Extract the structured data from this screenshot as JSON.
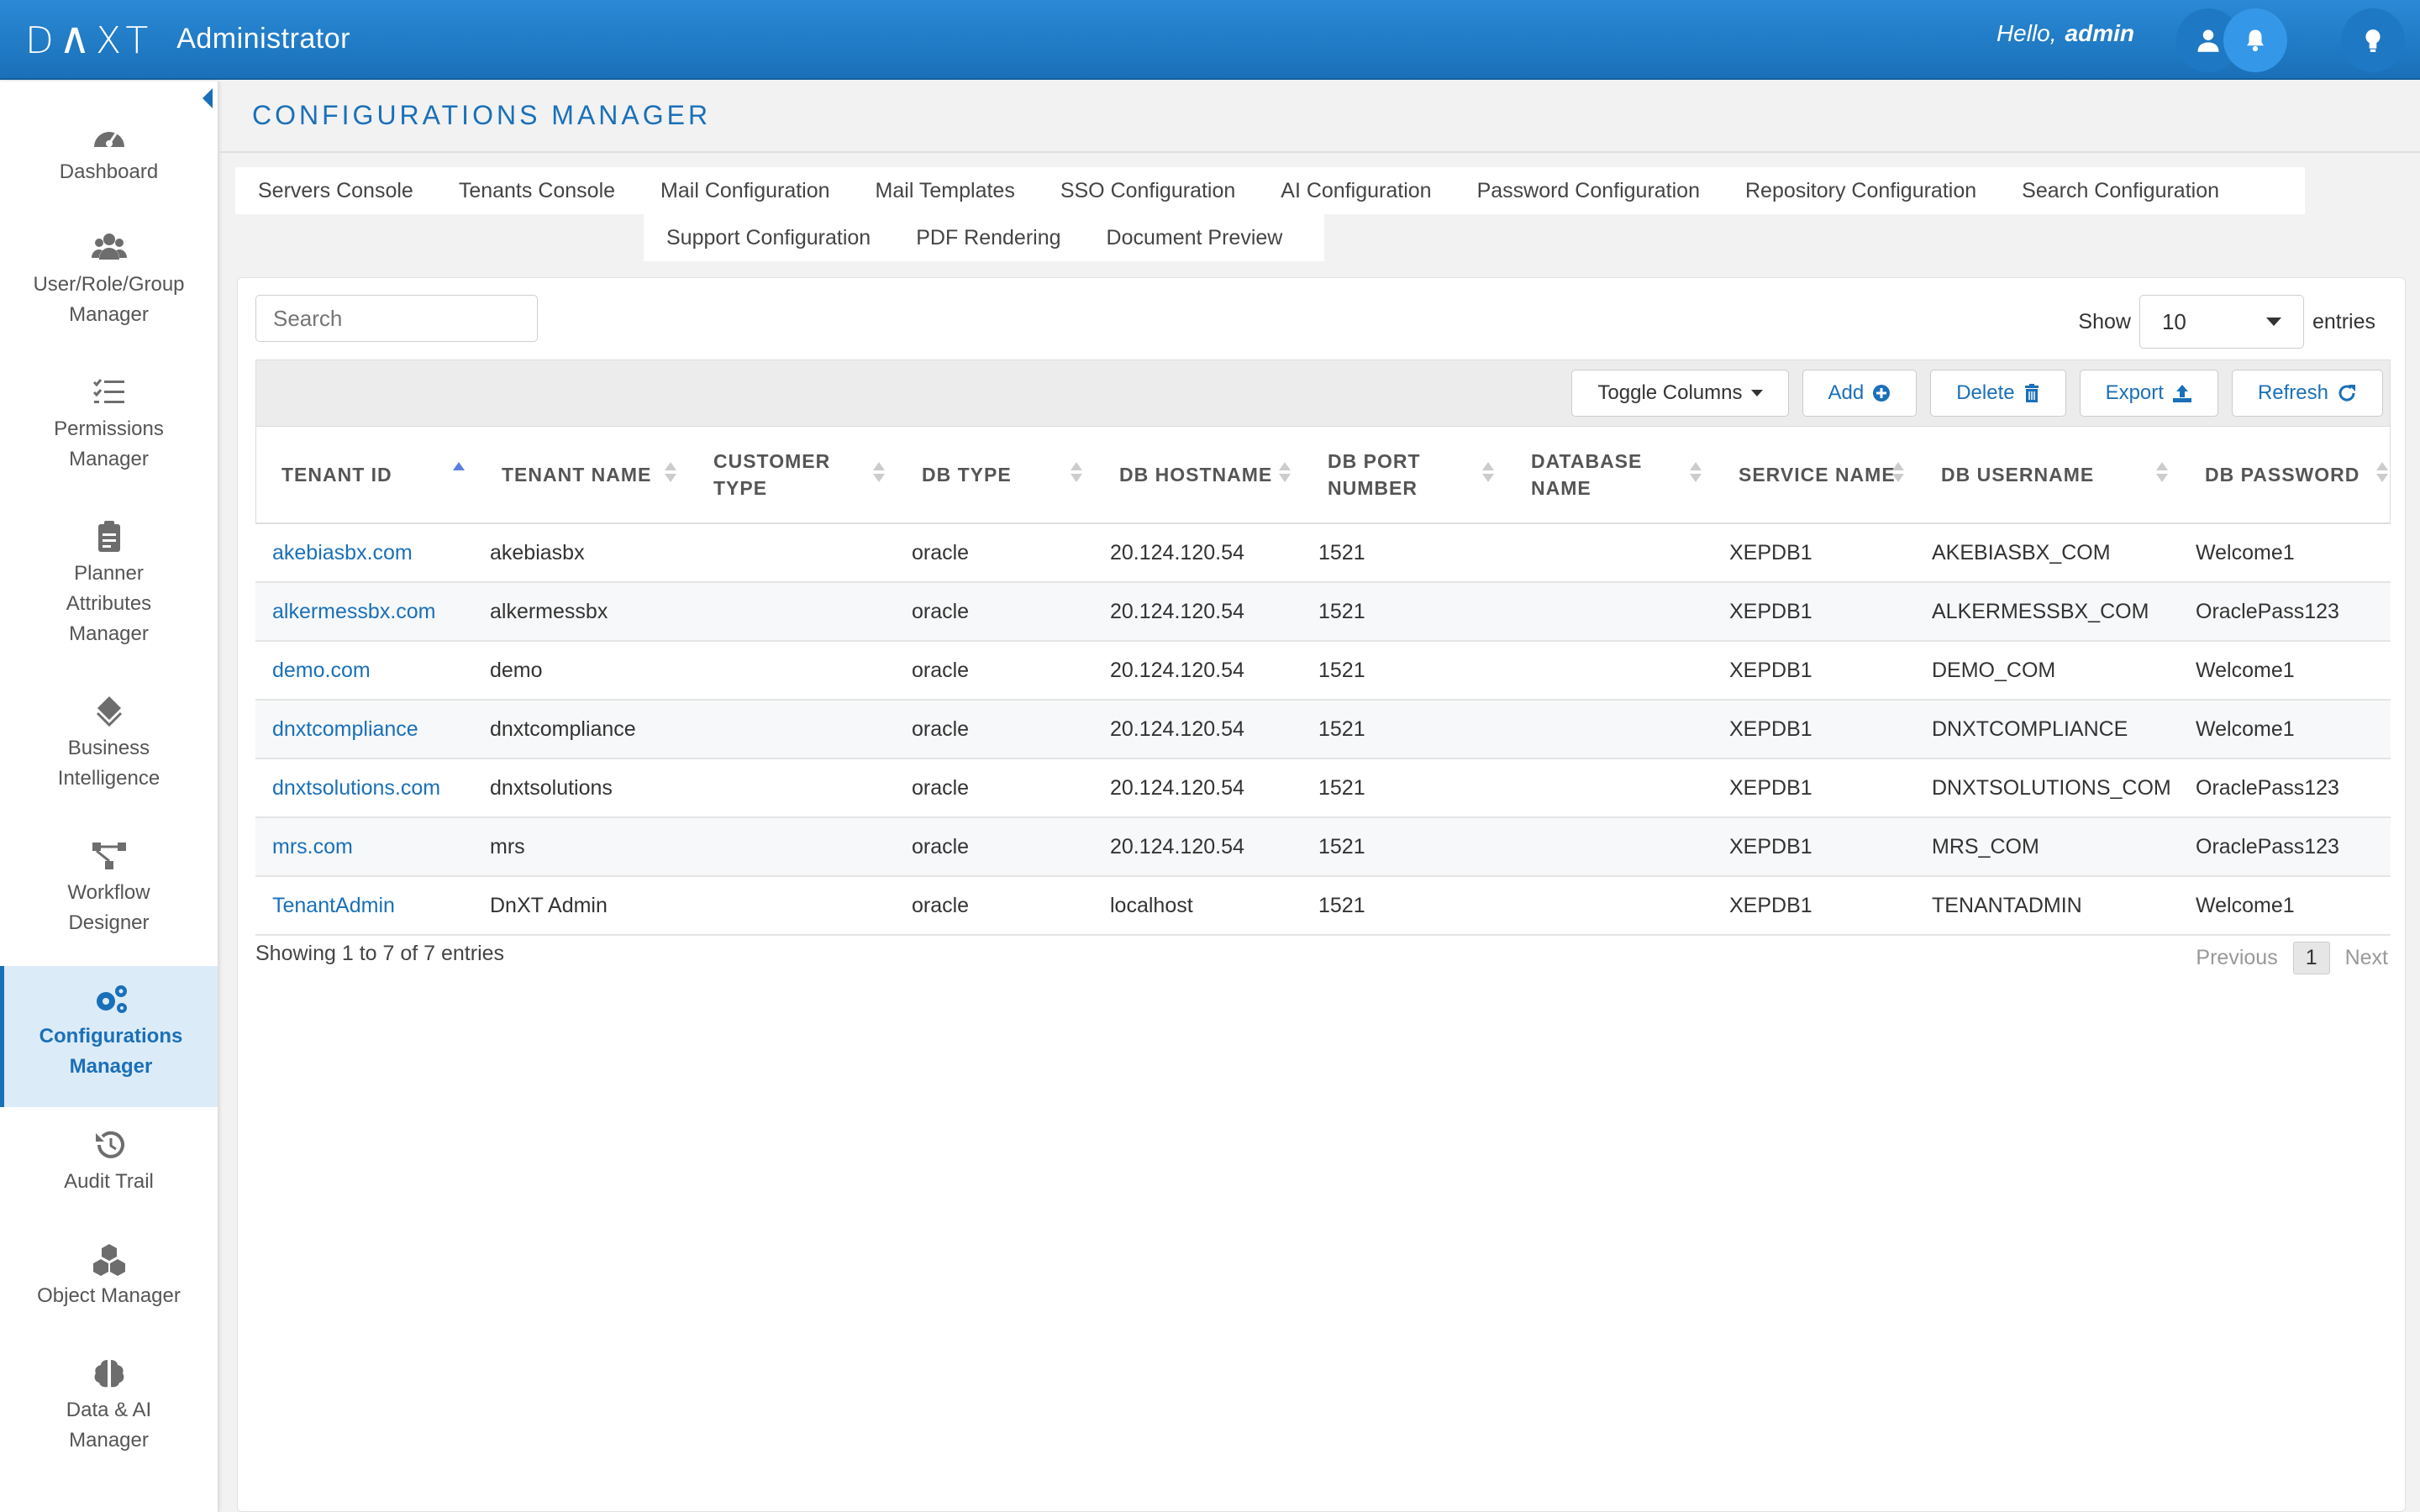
{
  "app": {
    "logo": "DNXT",
    "title": "Administrator",
    "greeting": "Hello,",
    "user": "admin"
  },
  "sidebar": {
    "items": [
      {
        "label": "Dashboard",
        "icon": "dashboard-icon"
      },
      {
        "label": "User/Role/Group Manager",
        "icon": "users-icon"
      },
      {
        "label": "Permissions Manager",
        "icon": "list-check-icon"
      },
      {
        "label": "Planner Attributes Manager",
        "icon": "clipboard-icon"
      },
      {
        "label": "Business Intelligence",
        "icon": "layers-icon"
      },
      {
        "label": "Workflow Designer",
        "icon": "workflow-icon"
      },
      {
        "label": "Configurations Manager",
        "icon": "gears-icon"
      },
      {
        "label": "Audit Trail",
        "icon": "history-icon"
      },
      {
        "label": "Object Manager",
        "icon": "cubes-icon"
      },
      {
        "label": "Data & AI Manager",
        "icon": "brain-icon"
      }
    ]
  },
  "page": {
    "title": "CONFIGURATIONS MANAGER"
  },
  "tabs": {
    "row1": [
      "Servers Console",
      "Tenants Console",
      "Mail Configuration",
      "Mail Templates",
      "SSO Configuration",
      "AI Configuration",
      "Password Configuration",
      "Repository Configuration",
      "Search Configuration"
    ],
    "row2": [
      "Support Configuration",
      "PDF Rendering",
      "Document Preview"
    ]
  },
  "search": {
    "placeholder": "Search"
  },
  "entries": {
    "show": "Show",
    "value": "10",
    "suffix": "entries"
  },
  "toolbar": {
    "toggle": "Toggle Columns",
    "add": "Add",
    "delete": "Delete",
    "export": "Export",
    "refresh": "Refresh"
  },
  "table": {
    "columns": [
      "TENANT ID",
      "TENANT NAME",
      "CUSTOMER TYPE",
      "DB TYPE",
      "DB HOSTNAME",
      "DB PORT NUMBER",
      "DATABASE NAME",
      "SERVICE NAME",
      "DB USERNAME",
      "DB PASSWORD"
    ],
    "rows": [
      [
        "akebiasbx.com",
        "akebiasbx",
        "",
        "oracle",
        "20.124.120.54",
        "1521",
        "",
        "XEPDB1",
        "AKEBIASBX_COM",
        "Welcome1"
      ],
      [
        "alkermessbx.com",
        "alkermessbx",
        "",
        "oracle",
        "20.124.120.54",
        "1521",
        "",
        "XEPDB1",
        "ALKERMESSBX_COM",
        "OraclePass123"
      ],
      [
        "demo.com",
        "demo",
        "",
        "oracle",
        "20.124.120.54",
        "1521",
        "",
        "XEPDB1",
        "DEMO_COM",
        "Welcome1"
      ],
      [
        "dnxtcompliance",
        "dnxtcompliance",
        "",
        "oracle",
        "20.124.120.54",
        "1521",
        "",
        "XEPDB1",
        "DNXTCOMPLIANCE",
        "Welcome1"
      ],
      [
        "dnxtsolutions.com",
        "dnxtsolutions",
        "",
        "oracle",
        "20.124.120.54",
        "1521",
        "",
        "XEPDB1",
        "DNXTSOLUTIONS_COM",
        "OraclePass123"
      ],
      [
        "mrs.com",
        "mrs",
        "",
        "oracle",
        "20.124.120.54",
        "1521",
        "",
        "XEPDB1",
        "MRS_COM",
        "OraclePass123"
      ],
      [
        "TenantAdmin",
        "DnXT Admin",
        "",
        "oracle",
        "localhost",
        "1521",
        "",
        "XEPDB1",
        "TENANTADMIN",
        "Welcome1"
      ]
    ]
  },
  "footer": {
    "info": "Showing 1 to 7 of 7 entries",
    "previous": "Previous",
    "page": "1",
    "next": "Next"
  },
  "colors": {
    "primary": "#1a70b8",
    "header": "#2a89d6",
    "active_bg": "#dcebf8"
  }
}
